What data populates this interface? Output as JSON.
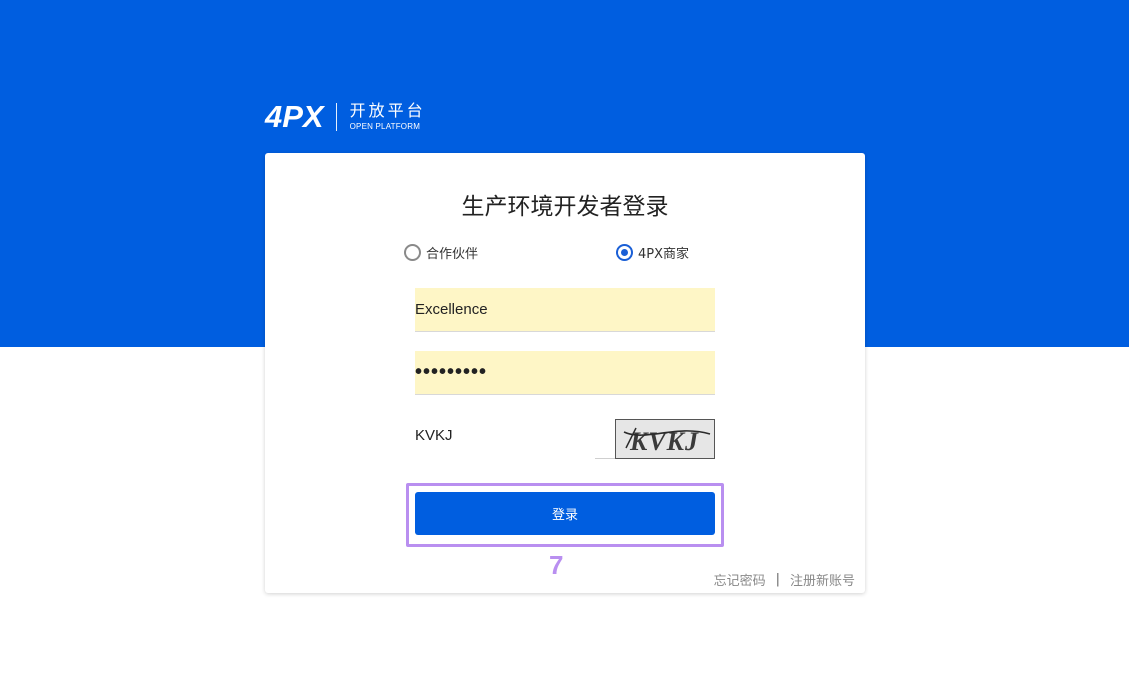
{
  "logo": {
    "mark": "4PX",
    "cn": "开放平台",
    "en": "OPEN PLATFORM"
  },
  "form": {
    "title": "生产环境开发者登录",
    "roles": [
      {
        "label": "合作伙伴",
        "checked": false
      },
      {
        "label": "4PX商家",
        "checked": true
      }
    ],
    "username_value": "Excellence",
    "password_mask": "•••••••••",
    "captcha_value": "KVKJ",
    "captcha_image_text": "KVKJ",
    "login_label": "登录",
    "forgot_label": "忘记密码",
    "separator": "|",
    "register_label": "注册新账号"
  },
  "annotation": {
    "marker": "7"
  },
  "colors": {
    "brand_blue": "#005ee0",
    "autofill_bg": "#fef6c6",
    "highlight": "#b98ff0"
  }
}
